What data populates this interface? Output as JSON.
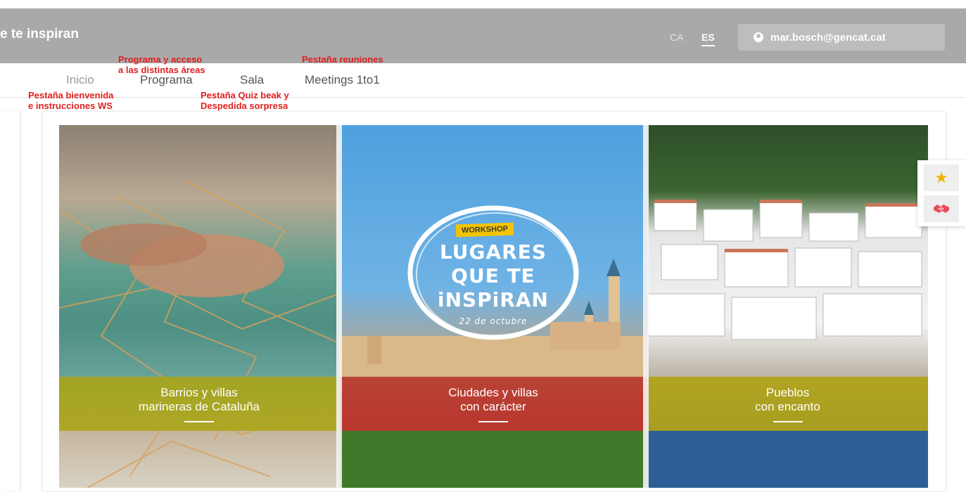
{
  "header": {
    "title": "e te inspiran",
    "lang_ca": "CA",
    "lang_es": "ES",
    "user_email": "mar.bosch@gencat.cat"
  },
  "nav": {
    "tabs": [
      {
        "label": "Inicio"
      },
      {
        "label": "Programa"
      },
      {
        "label": "Sala"
      },
      {
        "label": "Meetings 1to1"
      }
    ]
  },
  "annotations": {
    "programa": "Programa y acceso\na las distintas áreas",
    "reuniones": "Pestaña reuniones",
    "bienvenida": "Pestaña bienvenida\ne instrucciones WS",
    "quiz": "Pestaña Quiz beak y\nDespedida sorpresa"
  },
  "logo": {
    "badge": "WORKSHOP",
    "line1": "LUGARES",
    "line2": "QUE TE",
    "line3": "iNSPiRAN",
    "date": "22 de octubre"
  },
  "panels": [
    {
      "line1": "Barrios y villas",
      "line2": "marineras de Cataluña"
    },
    {
      "line1": "Ciudades y villas",
      "line2": "con carácter"
    },
    {
      "line1": "Pueblos",
      "line2": "con encanto"
    }
  ],
  "side_actions": {
    "favorite_icon": "star-icon",
    "meeting_icon": "handshake-icon"
  },
  "colors": {
    "topbar": "#a9a9a9",
    "band_green": "#aba410",
    "band_red": "#b7352c",
    "badge_yellow": "#f5c400"
  }
}
